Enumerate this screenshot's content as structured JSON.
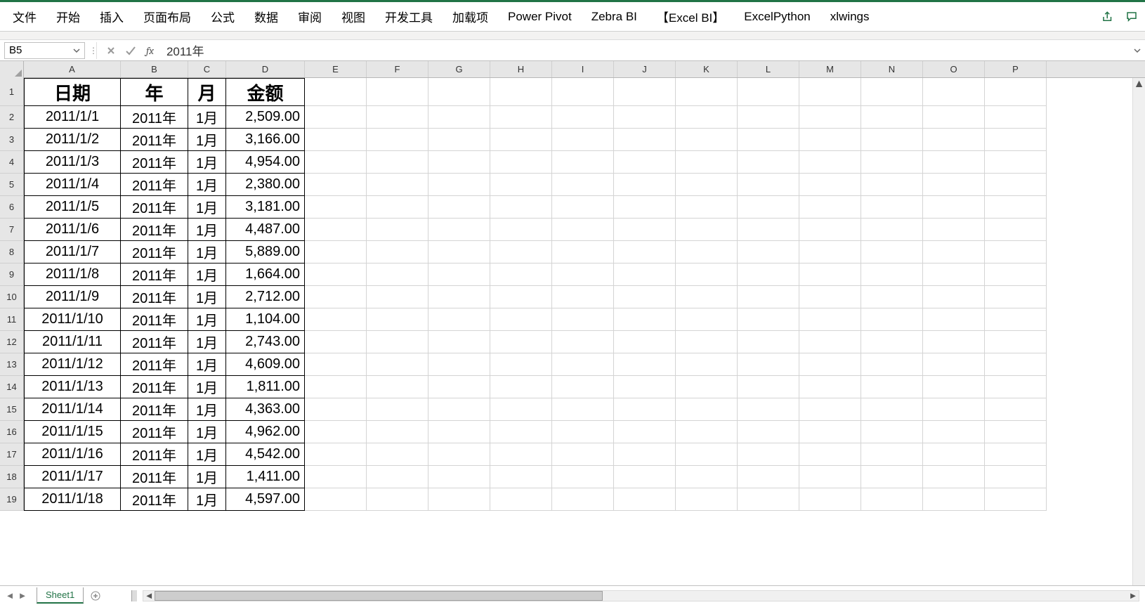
{
  "ribbon": {
    "tabs": [
      "文件",
      "开始",
      "插入",
      "页面布局",
      "公式",
      "数据",
      "审阅",
      "视图",
      "开发工具",
      "加载项",
      "Power Pivot",
      "Zebra BI",
      "【Excel BI】",
      "ExcelPython",
      "xlwings"
    ]
  },
  "namebox": {
    "value": "B5"
  },
  "formula": {
    "value": "2011年",
    "fx_label": "fx"
  },
  "columns": [
    "A",
    "B",
    "C",
    "D",
    "E",
    "F",
    "G",
    "H",
    "I",
    "J",
    "K",
    "L",
    "M",
    "N",
    "O",
    "P"
  ],
  "headers": {
    "A": "日期",
    "B": "年",
    "C": "月",
    "D": "金额"
  },
  "rows": [
    {
      "n": 2,
      "date": "2011/1/1",
      "year": "2011年",
      "month": "1月",
      "amount": "2,509.00"
    },
    {
      "n": 3,
      "date": "2011/1/2",
      "year": "2011年",
      "month": "1月",
      "amount": "3,166.00"
    },
    {
      "n": 4,
      "date": "2011/1/3",
      "year": "2011年",
      "month": "1月",
      "amount": "4,954.00"
    },
    {
      "n": 5,
      "date": "2011/1/4",
      "year": "2011年",
      "month": "1月",
      "amount": "2,380.00"
    },
    {
      "n": 6,
      "date": "2011/1/5",
      "year": "2011年",
      "month": "1月",
      "amount": "3,181.00"
    },
    {
      "n": 7,
      "date": "2011/1/6",
      "year": "2011年",
      "month": "1月",
      "amount": "4,487.00"
    },
    {
      "n": 8,
      "date": "2011/1/7",
      "year": "2011年",
      "month": "1月",
      "amount": "5,889.00"
    },
    {
      "n": 9,
      "date": "2011/1/8",
      "year": "2011年",
      "month": "1月",
      "amount": "1,664.00"
    },
    {
      "n": 10,
      "date": "2011/1/9",
      "year": "2011年",
      "month": "1月",
      "amount": "2,712.00"
    },
    {
      "n": 11,
      "date": "2011/1/10",
      "year": "2011年",
      "month": "1月",
      "amount": "1,104.00"
    },
    {
      "n": 12,
      "date": "2011/1/11",
      "year": "2011年",
      "month": "1月",
      "amount": "2,743.00"
    },
    {
      "n": 13,
      "date": "2011/1/12",
      "year": "2011年",
      "month": "1月",
      "amount": "4,609.00"
    },
    {
      "n": 14,
      "date": "2011/1/13",
      "year": "2011年",
      "month": "1月",
      "amount": "1,811.00"
    },
    {
      "n": 15,
      "date": "2011/1/14",
      "year": "2011年",
      "month": "1月",
      "amount": "4,363.00"
    },
    {
      "n": 16,
      "date": "2011/1/15",
      "year": "2011年",
      "month": "1月",
      "amount": "4,962.00"
    },
    {
      "n": 17,
      "date": "2011/1/16",
      "year": "2011年",
      "month": "1月",
      "amount": "4,542.00"
    },
    {
      "n": 18,
      "date": "2011/1/17",
      "year": "2011年",
      "month": "1月",
      "amount": "1,411.00"
    },
    {
      "n": 19,
      "date": "2011/1/18",
      "year": "2011年",
      "month": "1月",
      "amount": "4,597.00"
    }
  ],
  "sheet_tab": {
    "active": "Sheet1"
  }
}
